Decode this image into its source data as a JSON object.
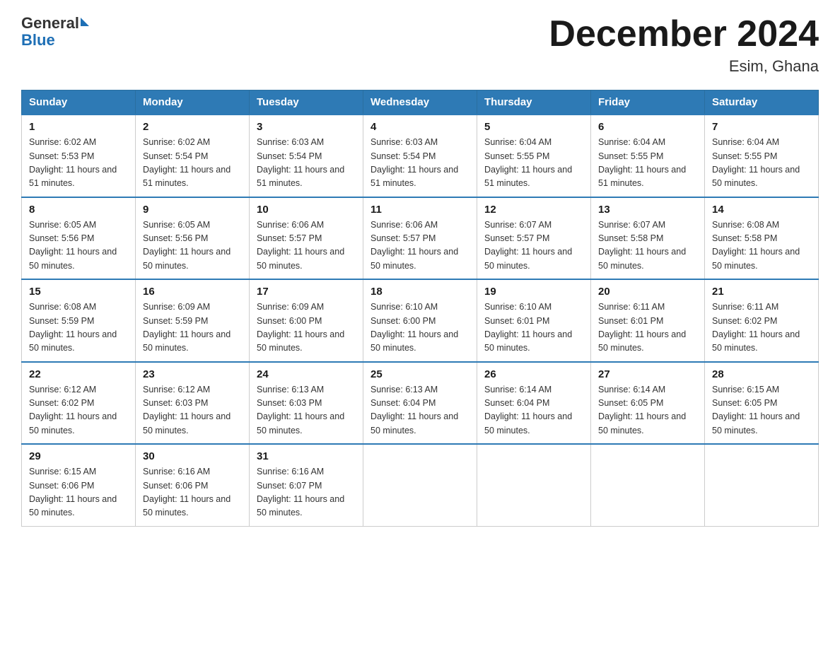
{
  "header": {
    "logo_general": "General",
    "logo_blue": "Blue",
    "month_title": "December 2024",
    "location": "Esim, Ghana"
  },
  "columns": [
    "Sunday",
    "Monday",
    "Tuesday",
    "Wednesday",
    "Thursday",
    "Friday",
    "Saturday"
  ],
  "weeks": [
    [
      {
        "day": "1",
        "sunrise": "6:02 AM",
        "sunset": "5:53 PM",
        "daylight": "11 hours and 51 minutes."
      },
      {
        "day": "2",
        "sunrise": "6:02 AM",
        "sunset": "5:54 PM",
        "daylight": "11 hours and 51 minutes."
      },
      {
        "day": "3",
        "sunrise": "6:03 AM",
        "sunset": "5:54 PM",
        "daylight": "11 hours and 51 minutes."
      },
      {
        "day": "4",
        "sunrise": "6:03 AM",
        "sunset": "5:54 PM",
        "daylight": "11 hours and 51 minutes."
      },
      {
        "day": "5",
        "sunrise": "6:04 AM",
        "sunset": "5:55 PM",
        "daylight": "11 hours and 51 minutes."
      },
      {
        "day": "6",
        "sunrise": "6:04 AM",
        "sunset": "5:55 PM",
        "daylight": "11 hours and 51 minutes."
      },
      {
        "day": "7",
        "sunrise": "6:04 AM",
        "sunset": "5:55 PM",
        "daylight": "11 hours and 50 minutes."
      }
    ],
    [
      {
        "day": "8",
        "sunrise": "6:05 AM",
        "sunset": "5:56 PM",
        "daylight": "11 hours and 50 minutes."
      },
      {
        "day": "9",
        "sunrise": "6:05 AM",
        "sunset": "5:56 PM",
        "daylight": "11 hours and 50 minutes."
      },
      {
        "day": "10",
        "sunrise": "6:06 AM",
        "sunset": "5:57 PM",
        "daylight": "11 hours and 50 minutes."
      },
      {
        "day": "11",
        "sunrise": "6:06 AM",
        "sunset": "5:57 PM",
        "daylight": "11 hours and 50 minutes."
      },
      {
        "day": "12",
        "sunrise": "6:07 AM",
        "sunset": "5:57 PM",
        "daylight": "11 hours and 50 minutes."
      },
      {
        "day": "13",
        "sunrise": "6:07 AM",
        "sunset": "5:58 PM",
        "daylight": "11 hours and 50 minutes."
      },
      {
        "day": "14",
        "sunrise": "6:08 AM",
        "sunset": "5:58 PM",
        "daylight": "11 hours and 50 minutes."
      }
    ],
    [
      {
        "day": "15",
        "sunrise": "6:08 AM",
        "sunset": "5:59 PM",
        "daylight": "11 hours and 50 minutes."
      },
      {
        "day": "16",
        "sunrise": "6:09 AM",
        "sunset": "5:59 PM",
        "daylight": "11 hours and 50 minutes."
      },
      {
        "day": "17",
        "sunrise": "6:09 AM",
        "sunset": "6:00 PM",
        "daylight": "11 hours and 50 minutes."
      },
      {
        "day": "18",
        "sunrise": "6:10 AM",
        "sunset": "6:00 PM",
        "daylight": "11 hours and 50 minutes."
      },
      {
        "day": "19",
        "sunrise": "6:10 AM",
        "sunset": "6:01 PM",
        "daylight": "11 hours and 50 minutes."
      },
      {
        "day": "20",
        "sunrise": "6:11 AM",
        "sunset": "6:01 PM",
        "daylight": "11 hours and 50 minutes."
      },
      {
        "day": "21",
        "sunrise": "6:11 AM",
        "sunset": "6:02 PM",
        "daylight": "11 hours and 50 minutes."
      }
    ],
    [
      {
        "day": "22",
        "sunrise": "6:12 AM",
        "sunset": "6:02 PM",
        "daylight": "11 hours and 50 minutes."
      },
      {
        "day": "23",
        "sunrise": "6:12 AM",
        "sunset": "6:03 PM",
        "daylight": "11 hours and 50 minutes."
      },
      {
        "day": "24",
        "sunrise": "6:13 AM",
        "sunset": "6:03 PM",
        "daylight": "11 hours and 50 minutes."
      },
      {
        "day": "25",
        "sunrise": "6:13 AM",
        "sunset": "6:04 PM",
        "daylight": "11 hours and 50 minutes."
      },
      {
        "day": "26",
        "sunrise": "6:14 AM",
        "sunset": "6:04 PM",
        "daylight": "11 hours and 50 minutes."
      },
      {
        "day": "27",
        "sunrise": "6:14 AM",
        "sunset": "6:05 PM",
        "daylight": "11 hours and 50 minutes."
      },
      {
        "day": "28",
        "sunrise": "6:15 AM",
        "sunset": "6:05 PM",
        "daylight": "11 hours and 50 minutes."
      }
    ],
    [
      {
        "day": "29",
        "sunrise": "6:15 AM",
        "sunset": "6:06 PM",
        "daylight": "11 hours and 50 minutes."
      },
      {
        "day": "30",
        "sunrise": "6:16 AM",
        "sunset": "6:06 PM",
        "daylight": "11 hours and 50 minutes."
      },
      {
        "day": "31",
        "sunrise": "6:16 AM",
        "sunset": "6:07 PM",
        "daylight": "11 hours and 50 minutes."
      },
      null,
      null,
      null,
      null
    ]
  ]
}
